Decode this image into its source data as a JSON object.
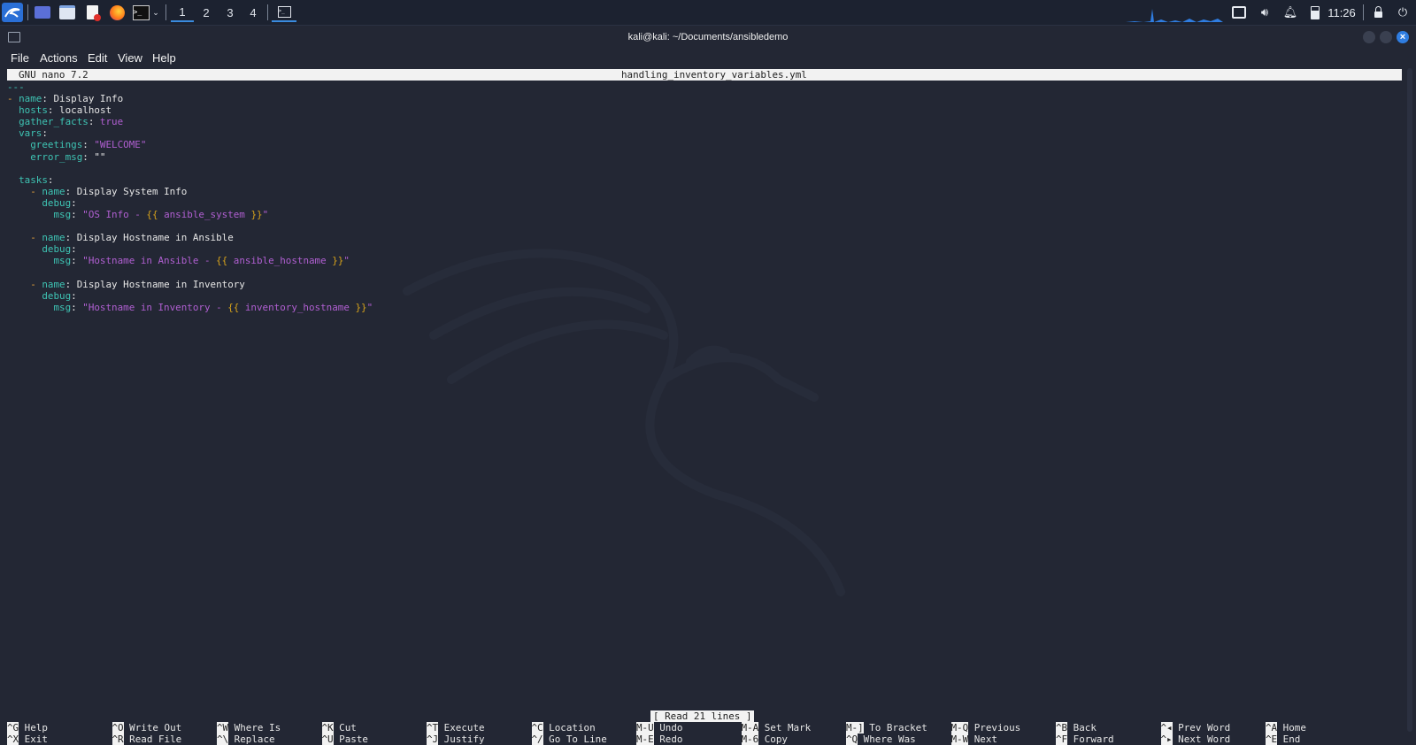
{
  "taskbar": {
    "workspaces": [
      "1",
      "2",
      "3",
      "4"
    ],
    "active_workspace": "1",
    "clock": "11:26"
  },
  "window": {
    "title": "kali@kali: ~/Documents/ansibledemo"
  },
  "menubar": {
    "items": [
      "File",
      "Actions",
      "Edit",
      "View",
      "Help"
    ]
  },
  "nano": {
    "version": "GNU nano 7.2",
    "filename": "handling_inventory_variables.yml",
    "status_message": "[ Read 21 lines ]",
    "lines": {
      "l0_marker": "---",
      "l1_dash": "- ",
      "l1_key": "name",
      "l1_val": " Display Info",
      "l2_key": "hosts",
      "l2_val": " localhost",
      "l3_key": "gather_facts",
      "l3_val": " true",
      "l4_key": "vars",
      "l5_key": "greetings",
      "l5_val": "\"WELCOME\"",
      "l6_key": "error_msg",
      "l6_val": " \"\"",
      "l8_key": "tasks",
      "t1_dash": "- ",
      "t1_key": "name",
      "t1_val": " Display System Info",
      "t1_debug": "debug",
      "t1_msg": "msg",
      "t1_s1": "\"OS Info - ",
      "t1_open": "{{",
      "t1_var": " ansible_system ",
      "t1_close": "}}",
      "t1_s2": "\"",
      "t2_dash": "- ",
      "t2_key": "name",
      "t2_val": " Display Hostname in Ansible",
      "t2_debug": "debug",
      "t2_msg": "msg",
      "t2_s1": "\"Hostname in Ansible - ",
      "t2_open": "{{",
      "t2_var": " ansible_hostname ",
      "t2_close": "}}",
      "t2_s2": "\"",
      "t3_dash": "- ",
      "t3_key": "name",
      "t3_val": " Display Hostname in Inventory",
      "t3_debug": "debug",
      "t3_msg": "msg",
      "t3_s1": "\"Hostname in Inventory - ",
      "t3_open": "{{",
      "t3_var": " inventory_hostname ",
      "t3_close": "}}",
      "t3_s2": "\""
    },
    "shortcuts": [
      {
        "key": "^G",
        "label": "Help"
      },
      {
        "key": "^X",
        "label": "Exit"
      },
      {
        "key": "^O",
        "label": "Write Out"
      },
      {
        "key": "^R",
        "label": "Read File"
      },
      {
        "key": "^W",
        "label": "Where Is"
      },
      {
        "key": "^\\",
        "label": "Replace"
      },
      {
        "key": "^K",
        "label": "Cut"
      },
      {
        "key": "^U",
        "label": "Paste"
      },
      {
        "key": "^T",
        "label": "Execute"
      },
      {
        "key": "^J",
        "label": "Justify"
      },
      {
        "key": "^C",
        "label": "Location"
      },
      {
        "key": "^/",
        "label": "Go To Line"
      },
      {
        "key": "M-U",
        "label": "Undo"
      },
      {
        "key": "M-E",
        "label": "Redo"
      },
      {
        "key": "M-A",
        "label": "Set Mark"
      },
      {
        "key": "M-6",
        "label": "Copy"
      },
      {
        "key": "M-]",
        "label": "To Bracket"
      },
      {
        "key": "^Q",
        "label": "Where Was"
      },
      {
        "key": "M-Q",
        "label": "Previous"
      },
      {
        "key": "M-W",
        "label": "Next"
      },
      {
        "key": "^B",
        "label": "Back"
      },
      {
        "key": "^F",
        "label": "Forward"
      },
      {
        "key": "^◂",
        "label": "Prev Word"
      },
      {
        "key": "^▸",
        "label": "Next Word"
      },
      {
        "key": "^A",
        "label": "Home"
      },
      {
        "key": "^E",
        "label": "End"
      }
    ]
  },
  "colors": {
    "background": "#232734",
    "accent": "#3a8bde",
    "yaml_key": "#3ec3b3",
    "yaml_string": "#b05fd1",
    "template_brace": "#d6a21b"
  }
}
